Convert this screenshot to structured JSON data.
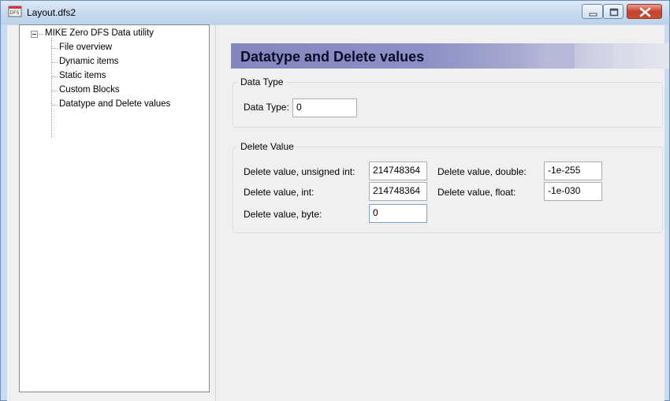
{
  "window": {
    "title": "Layout.dfs2",
    "minimize_glyph": "–",
    "maximize_glyph": "▫",
    "close_glyph": "✕"
  },
  "tree": {
    "root": "MIKE Zero DFS Data utility",
    "items": [
      "File overview",
      "Dynamic items",
      "Static items",
      "Custom Blocks",
      "Datatype and Delete values"
    ]
  },
  "header": {
    "title": "Datatype and Delete values"
  },
  "data_type": {
    "group_label": "Data Type",
    "label": "Data Type:",
    "value": "0"
  },
  "delete_value": {
    "group_label": "Delete Value",
    "unsigned_int_label": "Delete value, unsigned int:",
    "unsigned_int_value": "214748364",
    "int_label": "Delete value, int:",
    "int_value": "214748364",
    "byte_label": "Delete value, byte:",
    "byte_value": "0",
    "double_label": "Delete value, double:",
    "double_value": "-1e-255",
    "float_label": "Delete value, float:",
    "float_value": "-1e-030"
  },
  "colors": {
    "header_band": "#8487bd",
    "close_button": "#c8412b",
    "titlebar": "#c6d9ee"
  }
}
